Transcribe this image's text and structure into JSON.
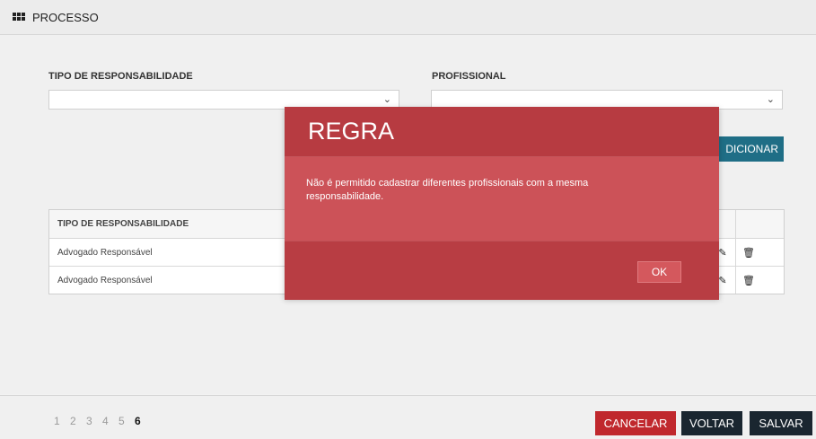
{
  "header": {
    "title": "PROCESSO",
    "icon": "grid-icon"
  },
  "form": {
    "type_label": "TIPO DE RESPONSABILIDADE",
    "type_value": "",
    "professional_label": "PROFISSIONAL",
    "professional_value": "",
    "add_button": "DICIONAR"
  },
  "table": {
    "header": "TIPO DE RESPONSABILIDADE",
    "rows": [
      {
        "type": "Advogado Responsável"
      },
      {
        "type": "Advogado Responsável"
      }
    ]
  },
  "pagination": {
    "pages": [
      "1",
      "2",
      "3",
      "4",
      "5",
      "6"
    ],
    "current": "6"
  },
  "footer": {
    "cancel": "CANCELAR",
    "back": "VOLTAR",
    "save": "SALVAR"
  },
  "modal": {
    "title": "REGRA",
    "message": "Não é permitido cadastrar diferentes profissionais com a mesma responsabilidade.",
    "ok": "OK"
  },
  "colors": {
    "modal_bg": "#c94d53",
    "cancel": "#c0282d",
    "primary_dark": "#1a2630",
    "add": "#1f6e86"
  }
}
